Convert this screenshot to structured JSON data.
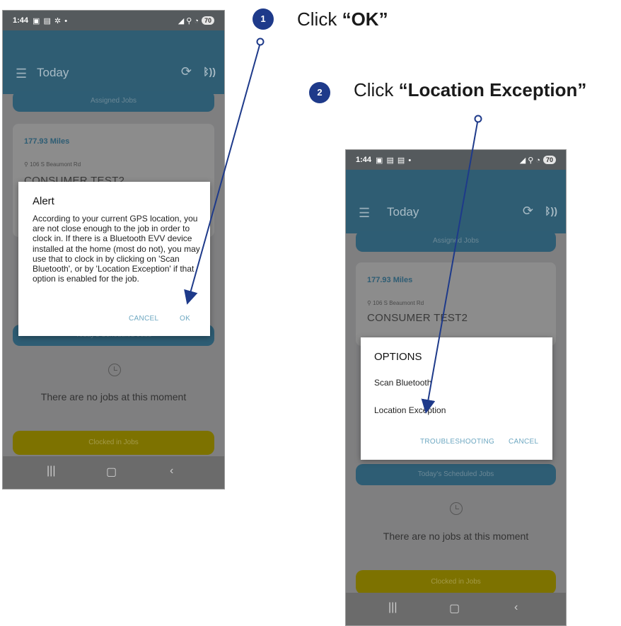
{
  "steps": [
    {
      "number": "1",
      "prefix": "Click ",
      "target": "“OK”"
    },
    {
      "number": "2",
      "prefix": "Click ",
      "target": "“Location Exception”"
    }
  ],
  "phone": {
    "time": "1:44",
    "battery": "70",
    "app_title": "Today",
    "assigned_jobs": "Assigned Jobs",
    "miles": "177.93 Miles",
    "address": "106 S Beaumont Rd",
    "consumer": "CONSUMER TEST2",
    "scheduled_jobs": "Today's Scheduled Jobs",
    "no_jobs": "There are no jobs at this moment",
    "clocked_in_jobs": "Clocked in Jobs"
  },
  "alert": {
    "title": "Alert",
    "message": "According to your current GPS location, you are not close enough to the job in order to clock in. If there is a Bluetooth EVV device installed at the home (most do not), you may use that to clock in by clicking on 'Scan Bluetooth', or by 'Location Exception' if that option is enabled for the job.",
    "cancel": "CANCEL",
    "ok": "OK"
  },
  "options": {
    "title": "OPTIONS",
    "items": [
      "Scan Bluetooth",
      "Location Exception"
    ],
    "troubleshooting": "TROUBLESHOOTING",
    "cancel": "CANCEL"
  },
  "colors": {
    "step_badge": "#1e3a8a",
    "arrow": "#1e3a8a",
    "app_bar": "#2f5d73",
    "dialog_button": "#6ea8c2",
    "clocked_in_button": "#7d7200"
  },
  "icons": [
    "menu-icon",
    "sync-icon",
    "bluetooth-icon",
    "location-pin-icon",
    "clock-icon",
    "recents-icon",
    "home-icon",
    "back-icon"
  ]
}
